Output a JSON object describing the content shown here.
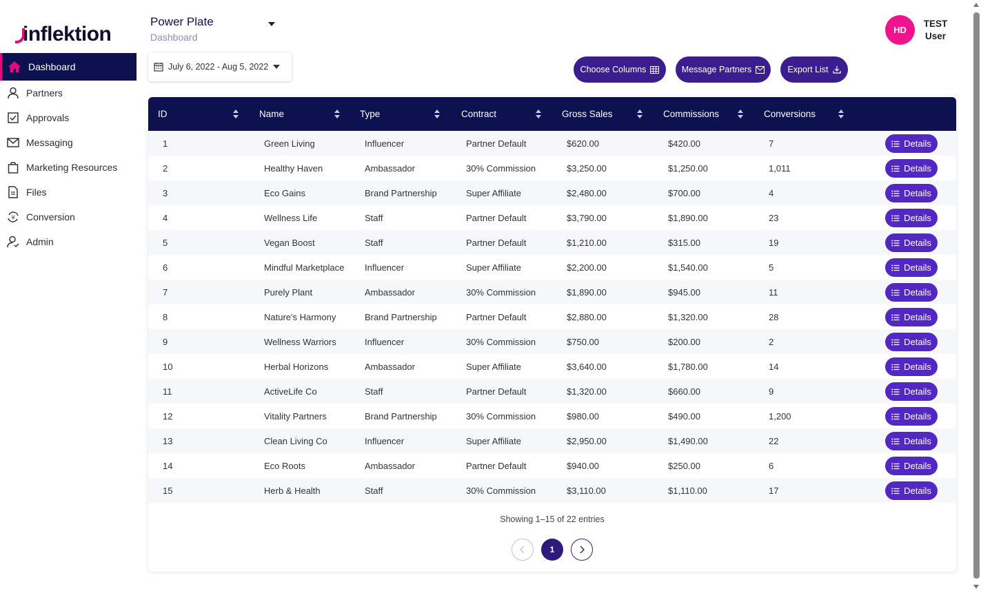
{
  "app": {
    "logo_text": "inflekt",
    "logo_suffix": "ion"
  },
  "sidebar": {
    "items": [
      {
        "label": "Dashboard",
        "icon": "home-icon",
        "active": true
      },
      {
        "label": "Partners",
        "icon": "user-icon"
      },
      {
        "label": "Approvals",
        "icon": "checkbox-icon"
      },
      {
        "label": "Messaging",
        "icon": "envelope-icon"
      },
      {
        "label": "Marketing Resources",
        "icon": "bag-icon"
      },
      {
        "label": "Files",
        "icon": "file-icon"
      },
      {
        "label": "Conversion",
        "icon": "currency-exchange-icon"
      },
      {
        "label": "Admin",
        "icon": "user-gear-icon"
      }
    ]
  },
  "header": {
    "brand": "Power Plate",
    "subtitle": "Dashboard",
    "date_range": "July 6, 2022 - Aug 5, 2022",
    "avatar_initials": "HD",
    "user_first": "TEST",
    "user_last": "User",
    "colors": {
      "primary": "#0d1150",
      "accent": "#3b1d8f",
      "pink": "#e4097d",
      "details": "#5227c4"
    }
  },
  "actions": {
    "choose_columns": "Choose Columns",
    "message_partners": "Message Partners",
    "export_list": "Export List"
  },
  "table": {
    "columns": [
      "ID",
      "Name",
      "Type",
      "Contract",
      "Gross Sales",
      "Commissions",
      "Conversions"
    ],
    "details_label": "Details",
    "rows": [
      [
        "1",
        "Green Living",
        "Influencer",
        "Partner Default",
        "$620.00",
        "$420.00",
        "7"
      ],
      [
        "2",
        "Healthy Haven",
        "Ambassador",
        "30% Commission",
        "$3,250.00",
        "$1,250.00",
        "1,011"
      ],
      [
        "3",
        "Eco Gains",
        "Brand Partnership",
        "Super Affiliate",
        "$2,480.00",
        "$700.00",
        "4"
      ],
      [
        "4",
        "Wellness Life",
        "Staff",
        "Partner Default",
        "$3,790.00",
        "$1,890.00",
        "23"
      ],
      [
        "5",
        "Vegan Boost",
        "Staff",
        "Partner Default",
        "$1,210.00",
        "$315.00",
        "19"
      ],
      [
        "6",
        "Mindful Marketplace",
        "Influencer",
        "Super Affiliate",
        "$2,200.00",
        "$1,540.00",
        "5"
      ],
      [
        "7",
        "Purely Plant",
        "Ambassador",
        "30% Commission",
        "$1,890.00",
        "$945.00",
        "11"
      ],
      [
        "8",
        "Nature's Harmony",
        "Brand Partnership",
        "Partner Default",
        "$2,880.00",
        "$1,320.00",
        "28"
      ],
      [
        "9",
        "Wellness Warriors",
        "Influencer",
        "30% Commission",
        "$750.00",
        "$200.00",
        "2"
      ],
      [
        "10",
        "Herbal Horizons",
        "Ambassador",
        "Super Affiliate",
        "$3,640.00",
        "$1,780.00",
        "14"
      ],
      [
        "11",
        "ActiveLife Co",
        "Staff",
        "Partner Default",
        "$1,320.00",
        "$660.00",
        "9"
      ],
      [
        "12",
        "Vitality Partners",
        "Brand Partnership",
        "30% Commission",
        "$980.00",
        "$490.00",
        "1,200"
      ],
      [
        "13",
        "Clean Living Co",
        "Influencer",
        "Super Affiliate",
        "$2,950.00",
        "$1,490.00",
        "22"
      ],
      [
        "14",
        "Eco Roots",
        "Ambassador",
        "Partner Default",
        "$940.00",
        "$250.00",
        "6"
      ],
      [
        "15",
        "Herb & Health",
        "Staff",
        "30% Commission",
        "$3,110.00",
        "$1,110.00",
        "17"
      ]
    ]
  },
  "pagination": {
    "summary": "Showing 1–15 of 22 entries",
    "current_page": "1"
  }
}
